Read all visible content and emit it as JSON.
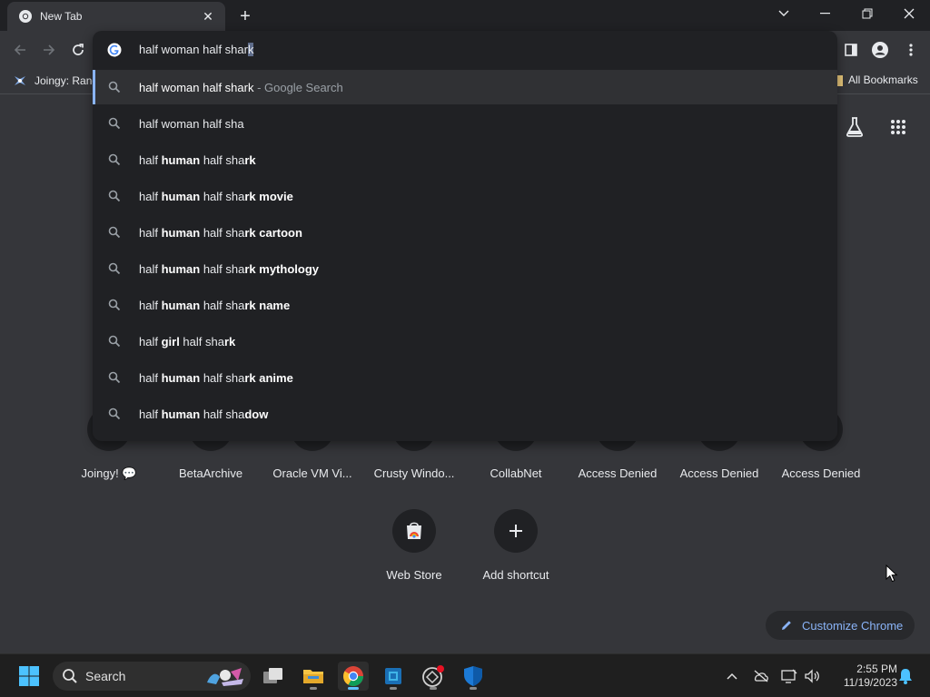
{
  "browser": {
    "tab": {
      "title": "New Tab"
    },
    "bookmarks": [
      {
        "label": "Joingy: Rand"
      }
    ],
    "all_bookmarks_label": "All Bookmarks"
  },
  "omnibox": {
    "typed_prefix": "half woman half sha",
    "typed_autocomplete_mid": "r",
    "typed_selected": "k",
    "active_suggestion": {
      "query": "half woman half shark",
      "suffix": " - Google Search"
    },
    "suggestions": [
      {
        "parts": [
          {
            "t": "half woman half sha",
            "b": false
          }
        ]
      },
      {
        "parts": [
          {
            "t": "half ",
            "b": false
          },
          {
            "t": "human",
            "b": true
          },
          {
            "t": " half sha",
            "b": false
          },
          {
            "t": "rk",
            "b": true
          }
        ]
      },
      {
        "parts": [
          {
            "t": "half ",
            "b": false
          },
          {
            "t": "human",
            "b": true
          },
          {
            "t": " half sha",
            "b": false
          },
          {
            "t": "rk movie",
            "b": true
          }
        ]
      },
      {
        "parts": [
          {
            "t": "half ",
            "b": false
          },
          {
            "t": "human",
            "b": true
          },
          {
            "t": " half sha",
            "b": false
          },
          {
            "t": "rk cartoon",
            "b": true
          }
        ]
      },
      {
        "parts": [
          {
            "t": "half ",
            "b": false
          },
          {
            "t": "human",
            "b": true
          },
          {
            "t": " half sha",
            "b": false
          },
          {
            "t": "rk mythology",
            "b": true
          }
        ]
      },
      {
        "parts": [
          {
            "t": "half ",
            "b": false
          },
          {
            "t": "human",
            "b": true
          },
          {
            "t": " half sha",
            "b": false
          },
          {
            "t": "rk name",
            "b": true
          }
        ]
      },
      {
        "parts": [
          {
            "t": "half ",
            "b": false
          },
          {
            "t": "girl",
            "b": true
          },
          {
            "t": " half sha",
            "b": false
          },
          {
            "t": "rk",
            "b": true
          }
        ]
      },
      {
        "parts": [
          {
            "t": "half ",
            "b": false
          },
          {
            "t": "human",
            "b": true
          },
          {
            "t": " half sha",
            "b": false
          },
          {
            "t": "rk anime",
            "b": true
          }
        ]
      },
      {
        "parts": [
          {
            "t": "half ",
            "b": false
          },
          {
            "t": "human",
            "b": true
          },
          {
            "t": " half sha",
            "b": false
          },
          {
            "t": "dow",
            "b": true
          }
        ]
      }
    ]
  },
  "ntp": {
    "shortcuts": [
      {
        "label": "Joingy! 💬"
      },
      {
        "label": "BetaArchive"
      },
      {
        "label": "Oracle VM Vi..."
      },
      {
        "label": "Crusty Windo..."
      },
      {
        "label": "CollabNet"
      },
      {
        "label": "Access Denied"
      },
      {
        "label": "Access Denied"
      },
      {
        "label": "Access Denied"
      }
    ],
    "web_store_label": "Web Store",
    "add_shortcut_label": "Add shortcut",
    "customize_label": "Customize Chrome"
  },
  "taskbar": {
    "search_label": "Search",
    "time": "2:55 PM",
    "date": "11/19/2023"
  },
  "colors": {
    "accent": "#8ab4f8",
    "background": "#35363a",
    "omnibox": "#202124"
  }
}
